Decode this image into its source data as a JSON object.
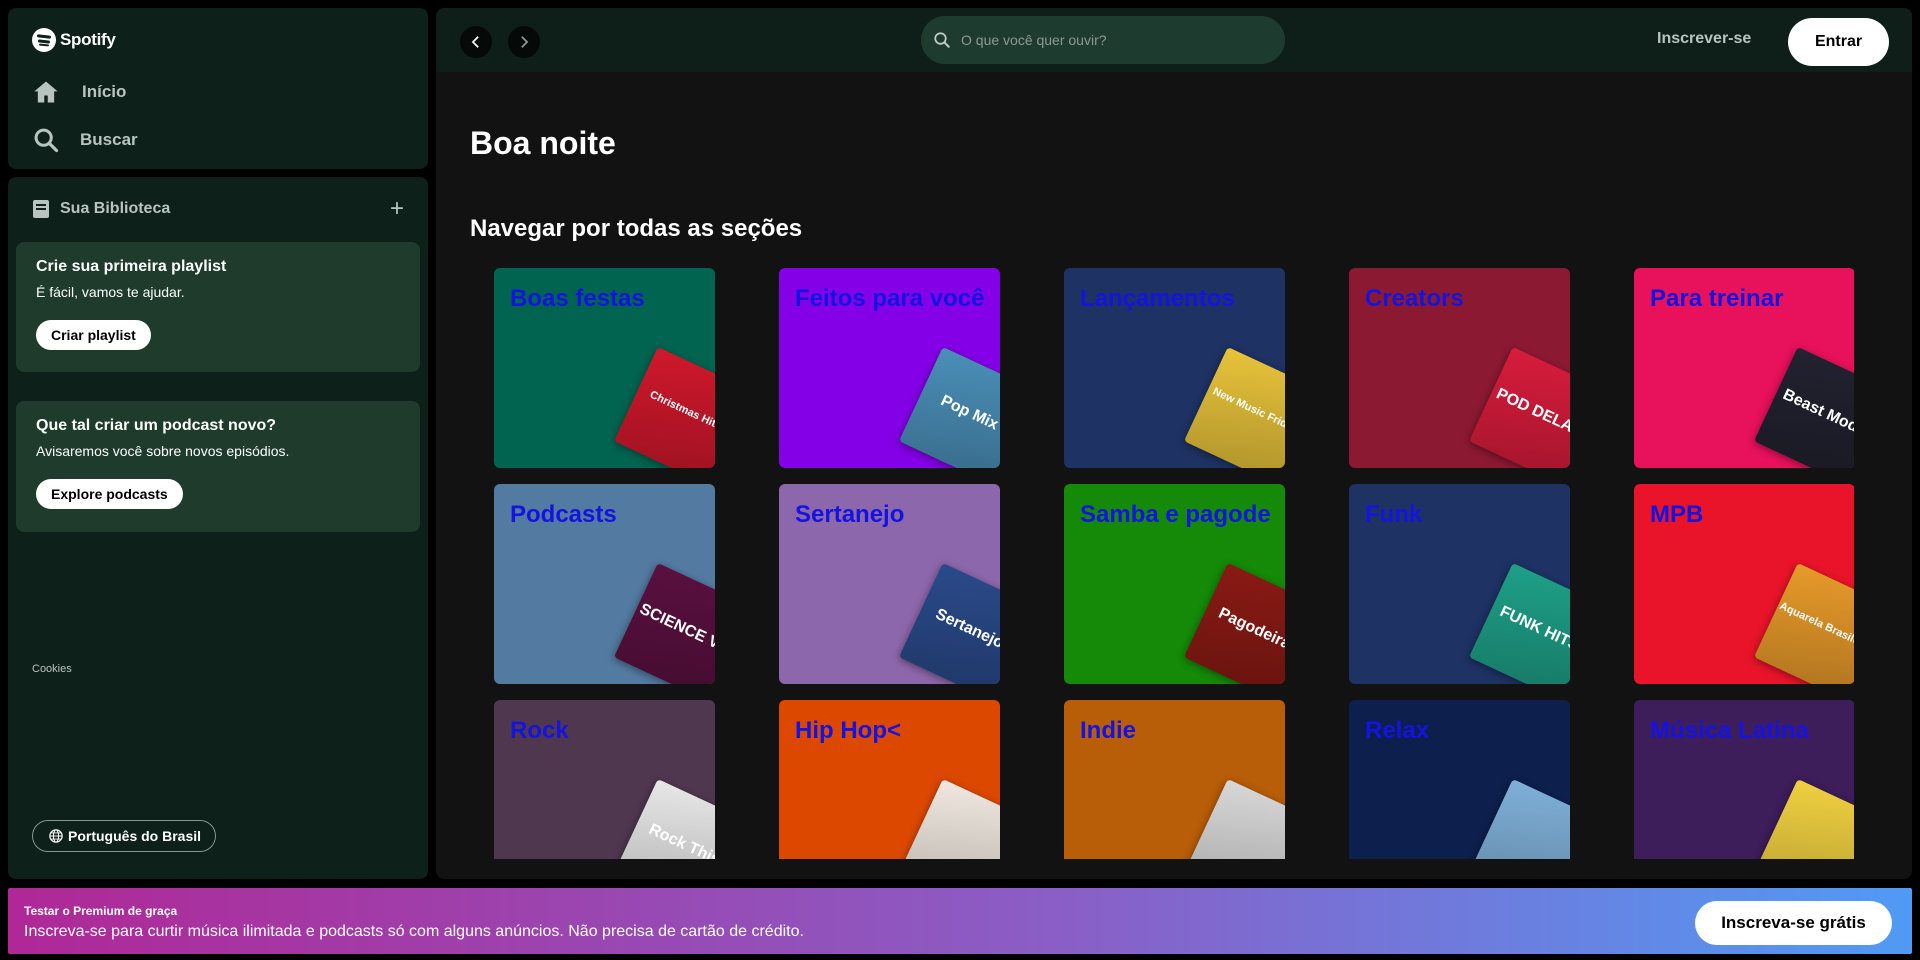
{
  "brand": {
    "name": "Spotify"
  },
  "nav": {
    "home_label": "Início",
    "search_label": "Buscar"
  },
  "library": {
    "title": "Sua Biblioteca",
    "cards": [
      {
        "title": "Crie sua primeira playlist",
        "text": "É fácil, vamos te ajudar.",
        "button": "Criar playlist"
      },
      {
        "title": "Que tal criar um podcast novo?",
        "text": "Avisaremos você sobre novos episódios.",
        "button": "Explore podcasts"
      }
    ],
    "cookies_label": "Cookies",
    "language_label": "Português do Brasil"
  },
  "topbar": {
    "search_placeholder": "O que você quer ouvir?",
    "signup_label": "Inscrever-se",
    "login_label": "Entrar"
  },
  "main": {
    "greeting": "Boa noite",
    "section_title": "Navegar por todas as seções",
    "categories": [
      {
        "title": "Boas festas",
        "bg": "#006450",
        "art_bg": "#d0182c",
        "art_text": "Christmas Hits"
      },
      {
        "title": "Feitos para você",
        "bg": "#8400e7",
        "art_bg": "#4a8fb8",
        "art_text": "Pop Mix"
      },
      {
        "title": "Lançamentos",
        "bg": "#1e3264",
        "art_bg": "#e8c33a",
        "art_text": "New Music Friday"
      },
      {
        "title": "Creators",
        "bg": "#8c1932",
        "art_bg": "#d81c3c",
        "art_text": "POD DELAS"
      },
      {
        "title": "Para treinar",
        "bg": "#e8115b",
        "art_bg": "#222230",
        "art_text": "Beast Mode"
      },
      {
        "title": "Podcasts",
        "bg": "#537aa1",
        "art_bg": "#5a1040",
        "art_text": "SCIENCE VS"
      },
      {
        "title": "Sertanejo",
        "bg": "#8d67ab",
        "art_bg": "#2a4a8a",
        "art_text": "Sertanejo"
      },
      {
        "title": "Samba e pagode",
        "bg": "#148a08",
        "art_bg": "#8a1a14",
        "art_text": "Pagodeira"
      },
      {
        "title": "Funk",
        "bg": "#1e3264",
        "art_bg": "#1ea088",
        "art_text": "FUNK HITS"
      },
      {
        "title": "MPB",
        "bg": "#e91429",
        "art_bg": "#e89a2a",
        "art_text": "Aquarela Brasileira"
      },
      {
        "title": "Rock",
        "bg": "#503750",
        "art_bg": "#e8e8e8",
        "art_text": "Rock This"
      },
      {
        "title": "Hip Hop<",
        "bg": "#dc4800",
        "art_bg": "#f0e8e0",
        "art_text": ""
      },
      {
        "title": "Indie",
        "bg": "#b85d08",
        "art_bg": "#d8d8d8",
        "art_text": ""
      },
      {
        "title": "Relax",
        "bg": "#0d1f4d",
        "art_bg": "#7fb0d8",
        "art_text": ""
      },
      {
        "title": "Música Latina",
        "bg": "#3d1d5a",
        "art_bg": "#f0d040",
        "art_text": ""
      }
    ]
  },
  "banner": {
    "small": "Testar o Premium de graça",
    "big": "Inscreva-se para curtir música ilimitada e podcasts só com alguns anúncios. Não precisa de cartão de crédito.",
    "button": "Inscreva-se grátis"
  }
}
